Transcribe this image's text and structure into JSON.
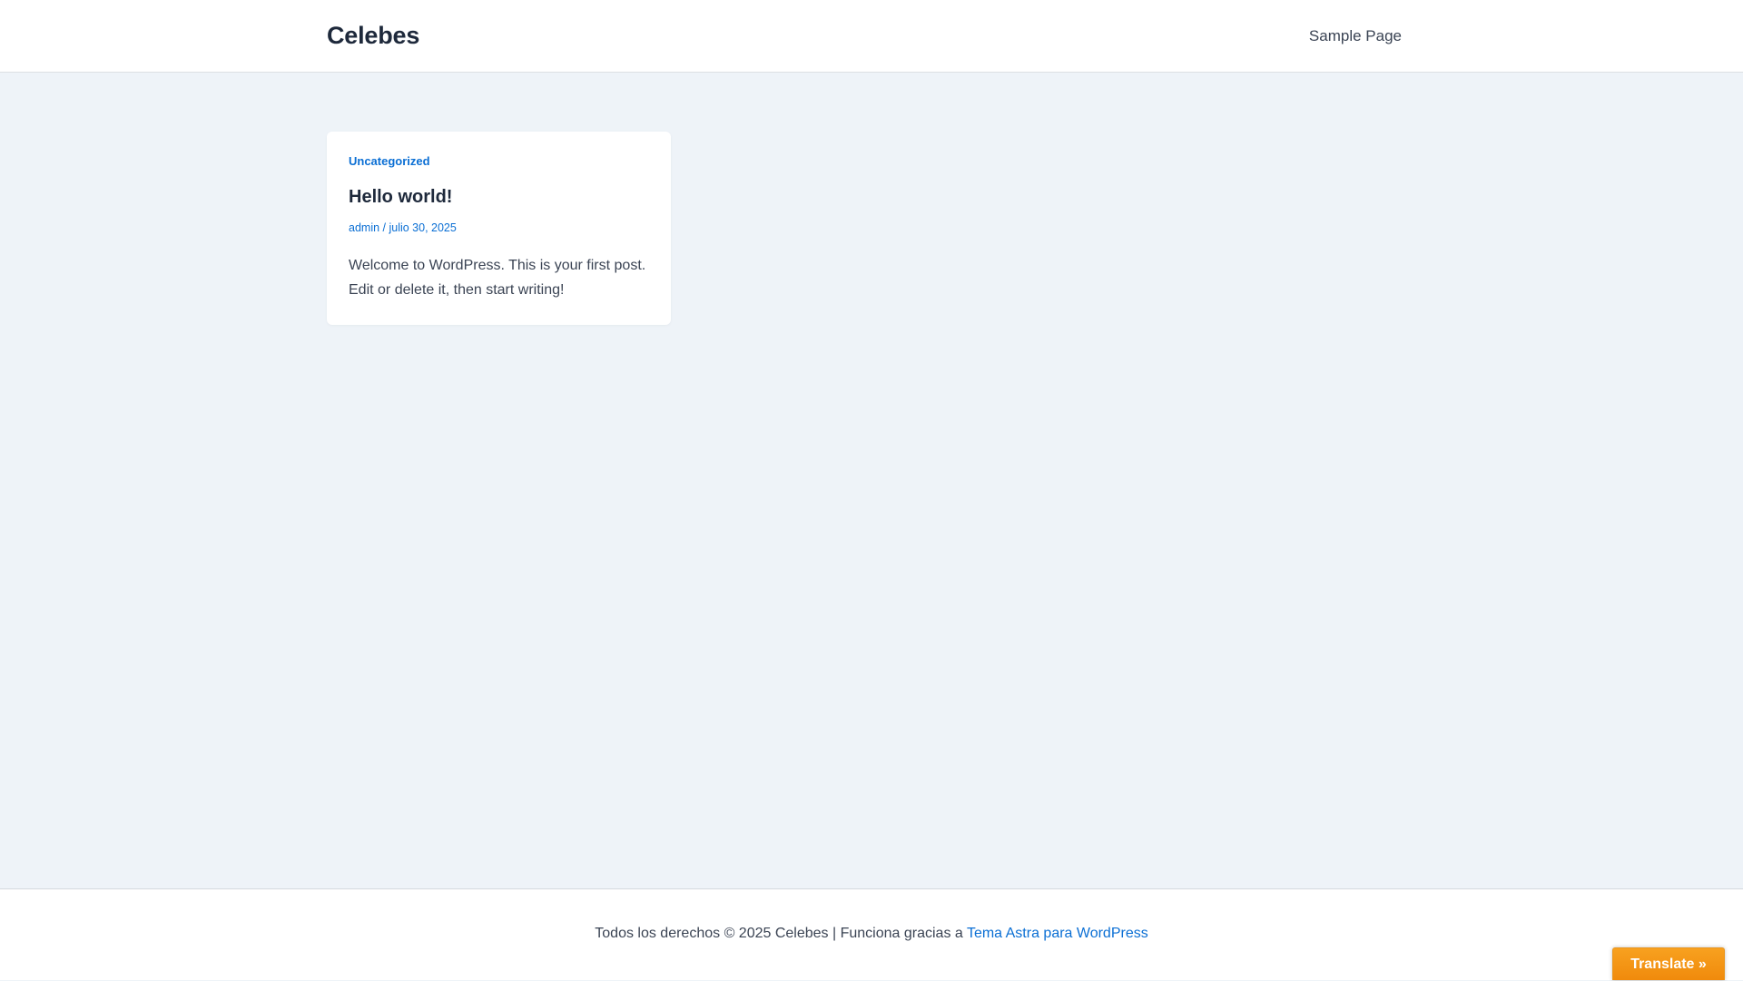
{
  "header": {
    "site_title": "Celebes",
    "nav": [
      {
        "label": "Sample Page"
      }
    ]
  },
  "post": {
    "category": "Uncategorized",
    "title": "Hello world!",
    "author": "admin",
    "meta_separator": " / ",
    "date": "julio 30, 2025",
    "excerpt": "Welcome to WordPress. This is your first post. Edit or delete it, then start writing!"
  },
  "footer": {
    "copyright": "Todos los derechos © 2025 Celebes | Funciona gracias a ",
    "theme_link": "Tema Astra para WordPress"
  },
  "translate": {
    "label": "Translate »"
  },
  "colors": {
    "accent": "#0b6fd4",
    "page_bg": "#eef3f8",
    "translate_bg": "#f39514"
  }
}
